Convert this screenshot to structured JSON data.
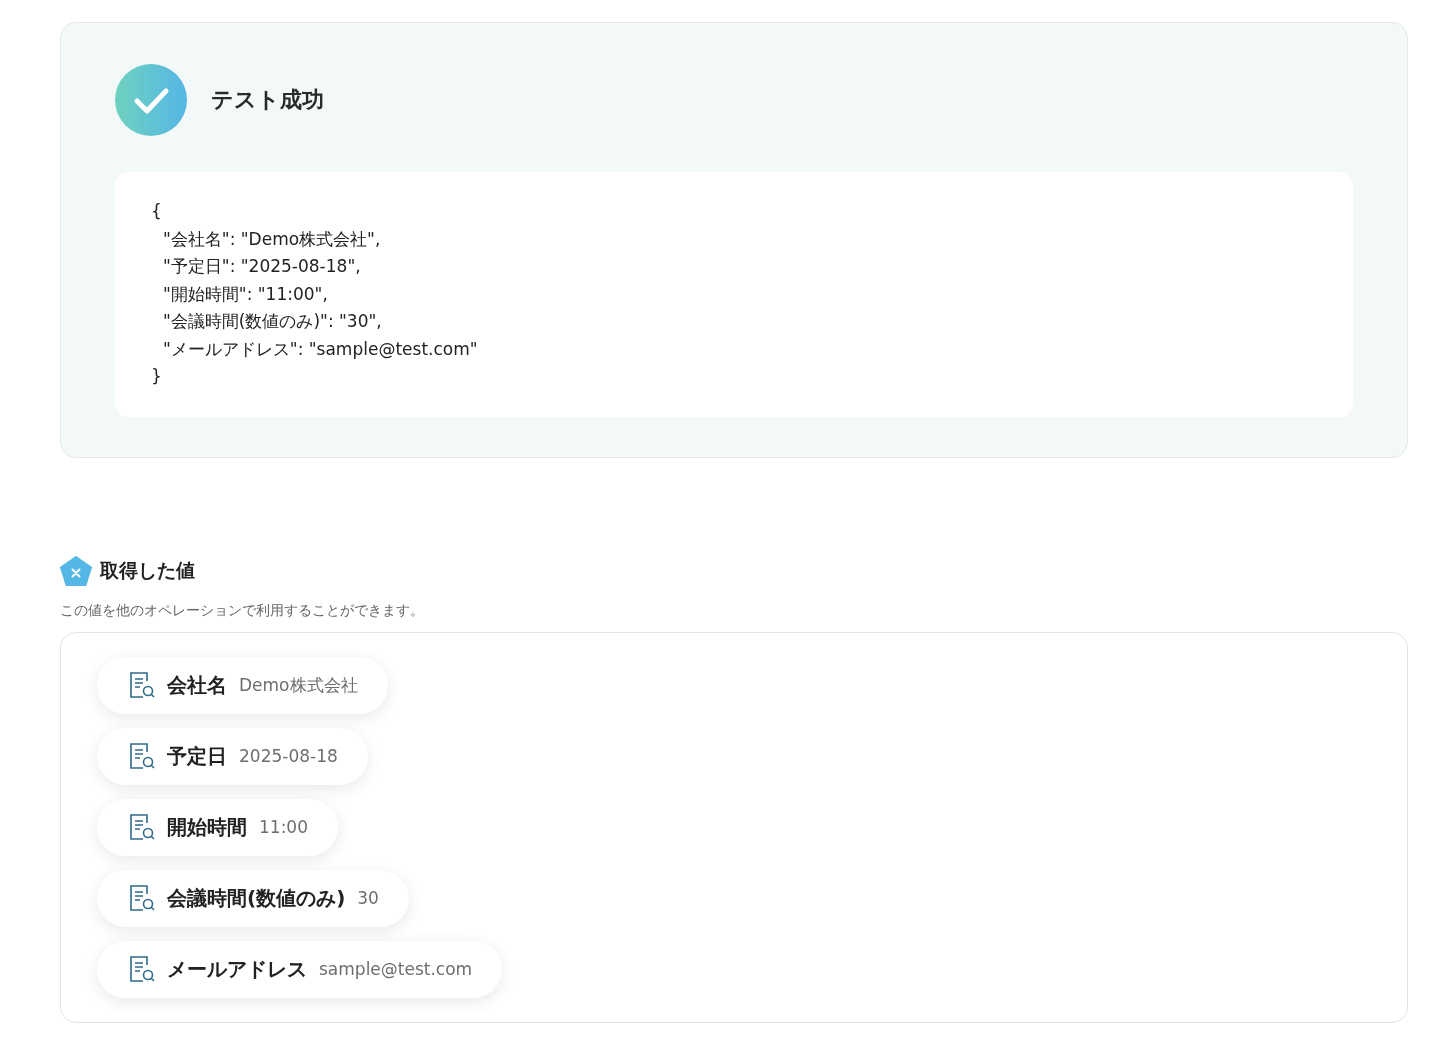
{
  "result": {
    "title": "テスト成功",
    "code": {
      "open": "{",
      "entries": [
        "\"会社名\": \"Demo株式会社\",",
        "\"予定日\": \"2025-08-18\",",
        "\"開始時間\": \"11:00\",",
        "\"会議時間(数値のみ)\": \"30\",",
        "\"メールアドレス\": \"sample@test.com\""
      ],
      "close": "}"
    }
  },
  "values": {
    "title": "取得した値",
    "description": "この値を他のオペレーションで利用することができます。",
    "items": [
      {
        "label": "会社名",
        "value": "Demo株式会社"
      },
      {
        "label": "予定日",
        "value": "2025-08-18"
      },
      {
        "label": "開始時間",
        "value": "11:00"
      },
      {
        "label": "会議時間(数値のみ)",
        "value": "30"
      },
      {
        "label": "メールアドレス",
        "value": "sample@test.com"
      }
    ]
  }
}
